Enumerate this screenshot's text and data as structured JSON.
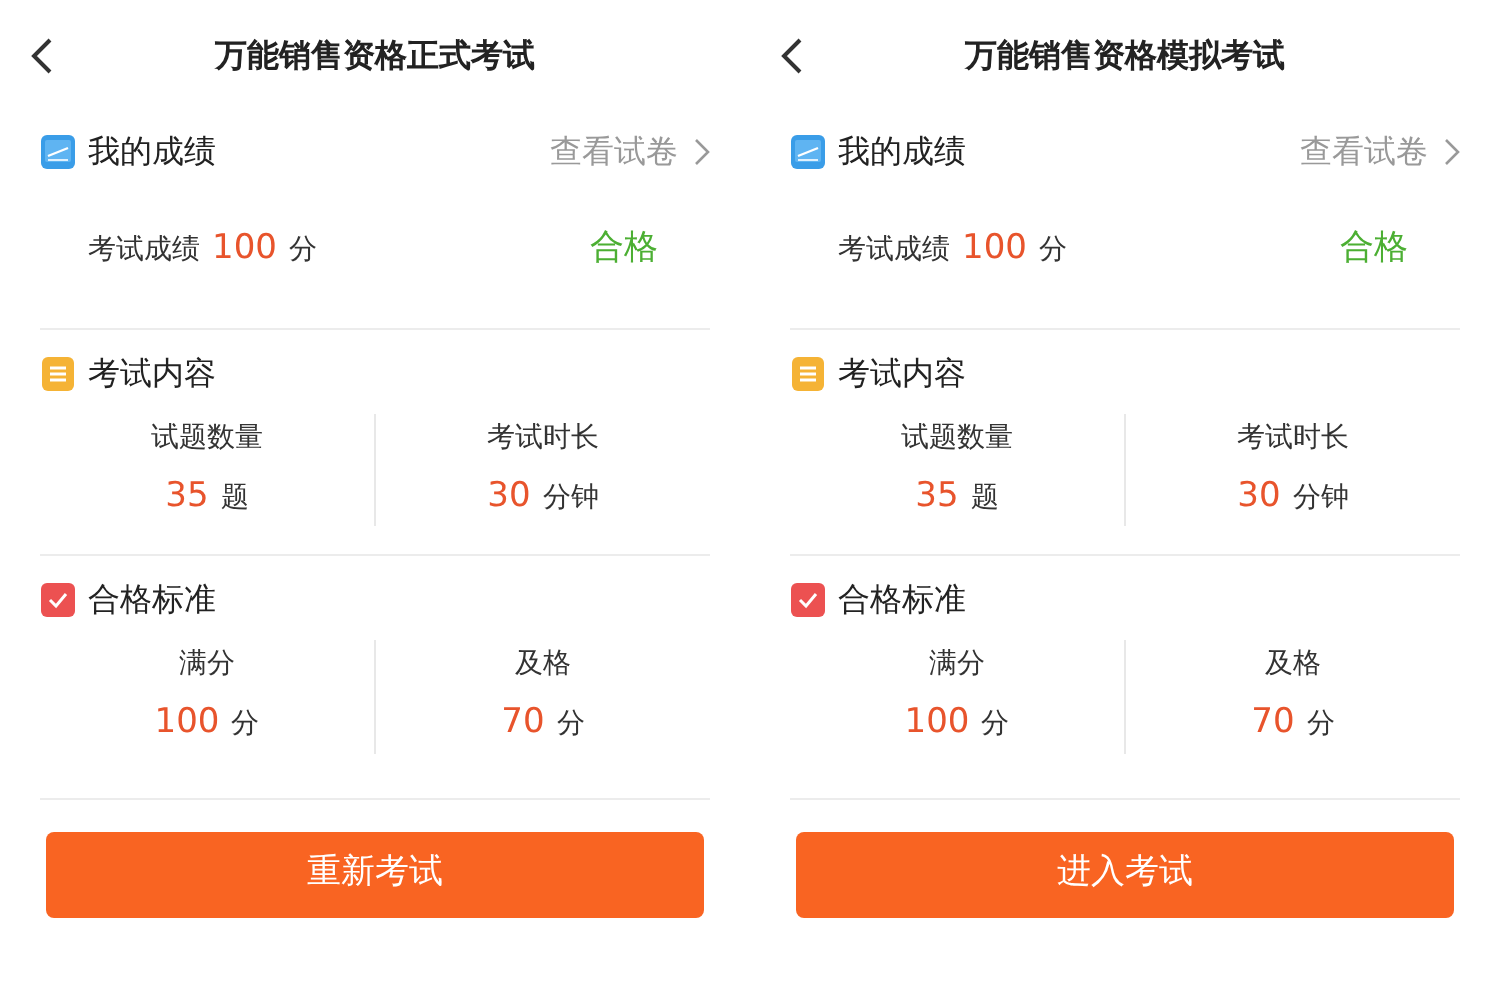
{
  "screens": [
    {
      "title": "万能销售资格正式考试",
      "score_section": {
        "heading": "我的成绩",
        "link": "查看试卷",
        "label": "考试成绩",
        "value": "100",
        "unit": "分",
        "result": "合格"
      },
      "content_section": {
        "heading": "考试内容",
        "stats": [
          {
            "label": "试题数量",
            "value": "35",
            "unit": "题"
          },
          {
            "label": "考试时长",
            "value": "30",
            "unit": "分钟"
          }
        ]
      },
      "standard_section": {
        "heading": "合格标准",
        "stats": [
          {
            "label": "满分",
            "value": "100",
            "unit": "分"
          },
          {
            "label": "及格",
            "value": "70",
            "unit": "分"
          }
        ]
      },
      "button": "重新考试"
    },
    {
      "title": "万能销售资格模拟考试",
      "score_section": {
        "heading": "我的成绩",
        "link": "查看试卷",
        "label": "考试成绩",
        "value": "100",
        "unit": "分",
        "result": "合格"
      },
      "content_section": {
        "heading": "考试内容",
        "stats": [
          {
            "label": "试题数量",
            "value": "35",
            "unit": "题"
          },
          {
            "label": "考试时长",
            "value": "30",
            "unit": "分钟"
          }
        ]
      },
      "standard_section": {
        "heading": "合格标准",
        "stats": [
          {
            "label": "满分",
            "value": "100",
            "unit": "分"
          },
          {
            "label": "及格",
            "value": "70",
            "unit": "分"
          }
        ]
      },
      "button": "进入考试"
    }
  ]
}
